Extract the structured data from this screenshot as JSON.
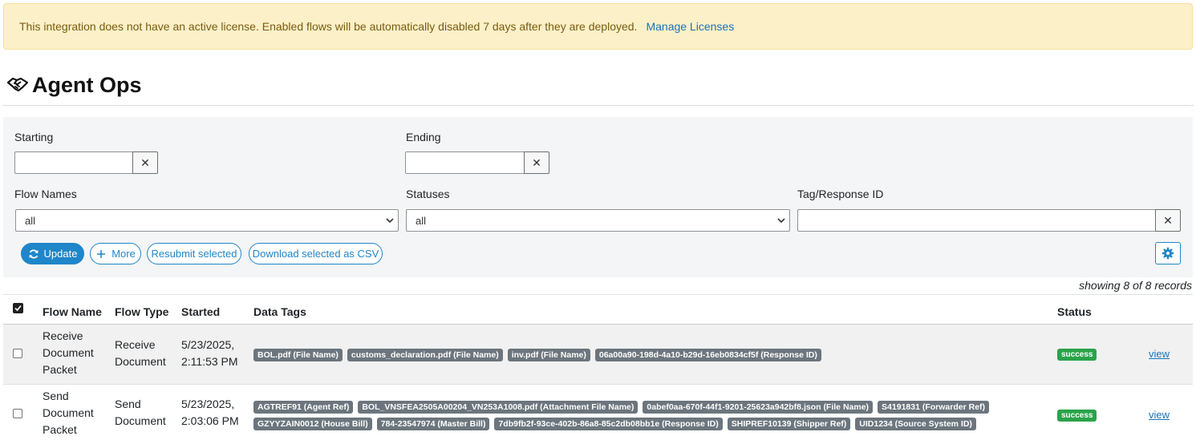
{
  "alert": {
    "message": "This integration does not have an active license. Enabled flows will be automatically disabled 7 days after they are deployed.",
    "link_label": "Manage Licenses"
  },
  "page": {
    "title": "Agent Ops",
    "title_icon": "handshake-icon"
  },
  "filters": {
    "starting_label": "Starting",
    "starting_value": "",
    "ending_label": "Ending",
    "ending_value": "",
    "clear_symbol": "✕",
    "flow_names_label": "Flow Names",
    "flow_names_value": "all",
    "statuses_label": "Statuses",
    "statuses_value": "all",
    "tag_label": "Tag/Response ID",
    "tag_value": ""
  },
  "actions": {
    "update": "Update",
    "more": "More",
    "resubmit": "Resubmit selected",
    "download": "Download selected as CSV"
  },
  "records_text": "showing 8 of 8 records",
  "table": {
    "headers": {
      "flow_name": "Flow Name",
      "flow_type": "Flow Type",
      "started": "Started",
      "data_tags": "Data Tags",
      "status": "Status"
    },
    "rows": [
      {
        "flow_name": [
          "Receive",
          "Document",
          "Packet"
        ],
        "flow_type": [
          "Receive",
          "Document"
        ],
        "started": [
          "5/23/2025,",
          "2:11:53 PM"
        ],
        "tags": [
          "BOL.pdf (File Name)",
          "customs_declaration.pdf (File Name)",
          "inv.pdf (File Name)",
          "06a00a90-198d-4a10-b29d-16eb0834cf5f (Response ID)"
        ],
        "status": "success",
        "action": "view"
      },
      {
        "flow_name": [
          "Send",
          "Document",
          "Packet"
        ],
        "flow_type": [
          "Send",
          "Document"
        ],
        "started": [
          "5/23/2025,",
          "2:03:06 PM"
        ],
        "tags": [
          "AGTREF91 (Agent Ref)",
          "BOL_VNSFEA2505A00204_VN253A1008.pdf (Attachment File Name)",
          "0abef0aa-670f-44f1-9201-25623a942bf8.json (File Name)",
          "S4191831 (Forwarder Ref)",
          "GZYYZAIN0012 (House Bill)",
          "784-23547974 (Master Bill)",
          "7db9fb2f-93ce-402b-86a8-85c2db08bb1e (Response ID)",
          "SHIPREF10139 (Shipper Ref)",
          "UID1234 (Source System ID)"
        ],
        "status": "success",
        "action": "view"
      }
    ]
  },
  "colors": {
    "alert_bg": "#fcf0c8",
    "primary": "#1f86c9",
    "success": "#2aa34a",
    "tag_bg": "#6c757d",
    "link": "#1a73b8"
  }
}
